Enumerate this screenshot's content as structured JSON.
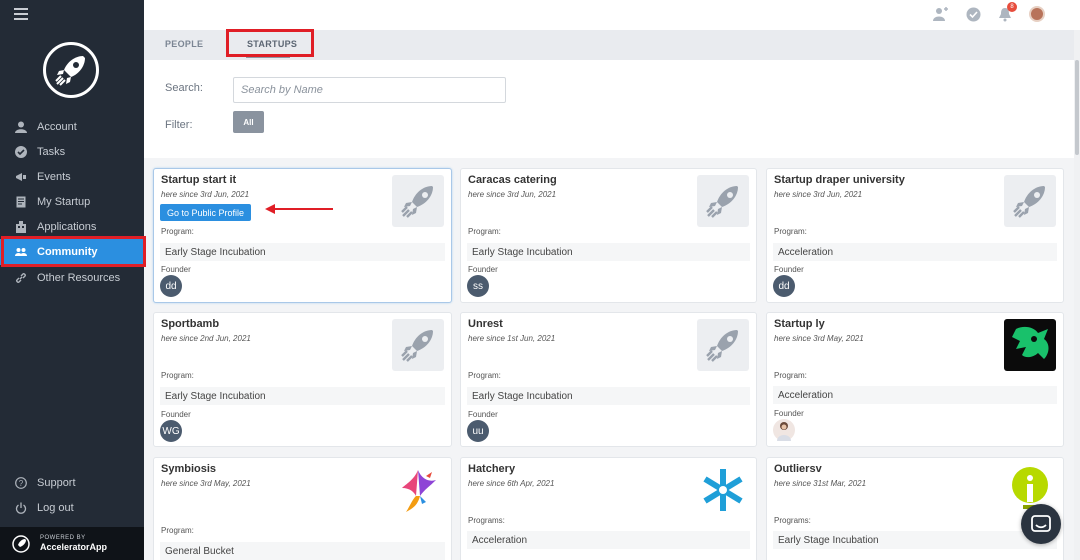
{
  "sidebar": {
    "items": [
      {
        "label": "Account",
        "icon": "user-icon"
      },
      {
        "label": "Tasks",
        "icon": "check-circle-icon"
      },
      {
        "label": "Events",
        "icon": "megaphone-icon"
      },
      {
        "label": "My Startup",
        "icon": "document-icon"
      },
      {
        "label": "Applications",
        "icon": "building-icon"
      },
      {
        "label": "Community",
        "icon": "people-icon",
        "active": true
      },
      {
        "label": "Other Resources",
        "icon": "link-icon"
      }
    ],
    "bottom": [
      {
        "label": "Support",
        "icon": "question-icon"
      },
      {
        "label": "Log out",
        "icon": "power-icon"
      }
    ],
    "powered_by": "POWERED BY",
    "brand": "AcceleratorApp"
  },
  "topbar": {
    "notification_count": "8"
  },
  "tabs": {
    "people": "PEOPLE",
    "startups": "STARTUPS",
    "active": "startups"
  },
  "filters": {
    "search_label": "Search:",
    "search_placeholder": "Search by Name",
    "filter_label": "Filter:",
    "all_button": "All"
  },
  "cards": [
    {
      "name": "Startup start it",
      "since": "here since 3rd Jun, 2021",
      "button": "Go to Public Profile",
      "program_label": "Program:",
      "program": "Early Stage Incubation",
      "founder_label": "Founder",
      "founder": "dd",
      "logo": "rocket-icon"
    },
    {
      "name": "Caracas catering",
      "since": "here since 3rd Jun, 2021",
      "program_label": "Program:",
      "program": "Early Stage Incubation",
      "founder_label": "Founder",
      "founder": "ss",
      "logo": "rocket-icon"
    },
    {
      "name": "Startup draper university",
      "since": "here since 3rd Jun, 2021",
      "program_label": "Program:",
      "program": "Acceleration",
      "founder_label": "Founder",
      "founder": "dd",
      "logo": "rocket-icon"
    },
    {
      "name": "Sportbamb",
      "since": "here since 2nd Jun, 2021",
      "program_label": "Program:",
      "program": "Early Stage Incubation",
      "founder_label": "Founder",
      "founder": "WG",
      "logo": "rocket-icon"
    },
    {
      "name": "Unrest",
      "since": "here since 1st Jun, 2021",
      "program_label": "Program:",
      "program": "Early Stage Incubation",
      "founder_label": "Founder",
      "founder": "uu",
      "logo": "rocket-icon"
    },
    {
      "name": "Startup ly",
      "since": "here since 3rd May, 2021",
      "program_label": "Program:",
      "program": "Acceleration",
      "founder_label": "Founder",
      "founder": "",
      "logo": "green-creature-logo"
    },
    {
      "name": "Symbiosis",
      "since": "here since 3rd May, 2021",
      "program_label": "Program:",
      "program": "General Bucket",
      "logo": "hummingbird-logo"
    },
    {
      "name": "Hatchery",
      "since": "here since 6th Apr, 2021",
      "program_label": "Programs:",
      "program": "Acceleration",
      "logo": "snowflake-logo"
    },
    {
      "name": "Outliersv",
      "since": "here since 31st Mar, 2021",
      "program_label": "Programs:",
      "program": "Early Stage Incubation",
      "logo": "lightbulb-logo"
    }
  ],
  "colors": {
    "sidebar_bg": "#232b36",
    "accent": "#2b8fe0",
    "highlight_outline": "#e01e26"
  }
}
